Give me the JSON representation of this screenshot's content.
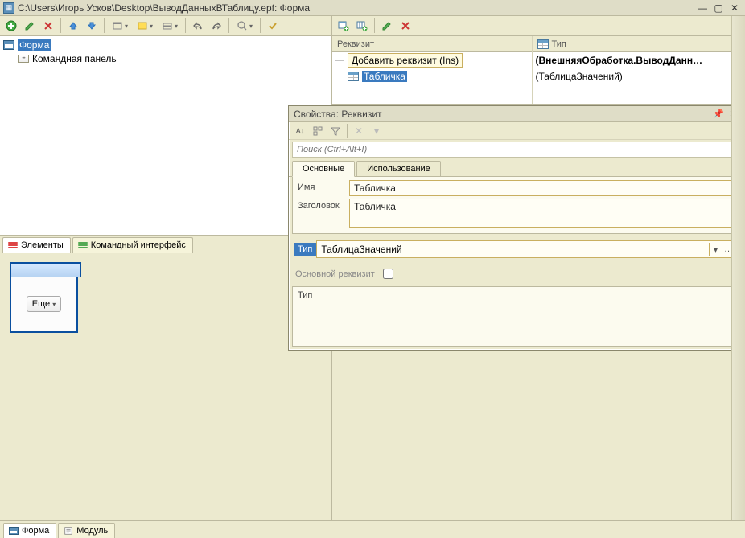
{
  "title": "C:\\Users\\Игорь Усков\\Desktop\\ВыводДанныхВТаблицу.epf: Форма",
  "left_tree": {
    "root": "Форма",
    "child": "Командная панель"
  },
  "left_tabs": {
    "elements": "Элементы",
    "cmd_iface": "Командный интерфейс"
  },
  "preview_button": "Еще",
  "right_table": {
    "col_req": "Реквизит",
    "col_type": "Тип",
    "add_row": "Добавить реквизит (Ins)",
    "req_value": "Табличка",
    "type_value_bold": "(ВнешняяОбработка.ВыводДанн…",
    "type_value_plain": "(ТаблицаЗначений)"
  },
  "props": {
    "title": "Свойства: Реквизит",
    "search_placeholder": "Поиск (Ctrl+Alt+I)",
    "tab_main": "Основные",
    "tab_usage": "Использование",
    "label_name": "Имя",
    "value_name": "Табличка",
    "label_title": "Заголовок",
    "value_title": "Табличка",
    "label_type": "Тип",
    "value_type": "ТаблицаЗначений",
    "label_main_req": "Основной реквизит",
    "footer_label": "Тип"
  },
  "bottom_tabs": {
    "form": "Форма",
    "module": "Модуль"
  },
  "colors": {
    "accent": "#3a7abf",
    "panel": "#eceacf"
  }
}
